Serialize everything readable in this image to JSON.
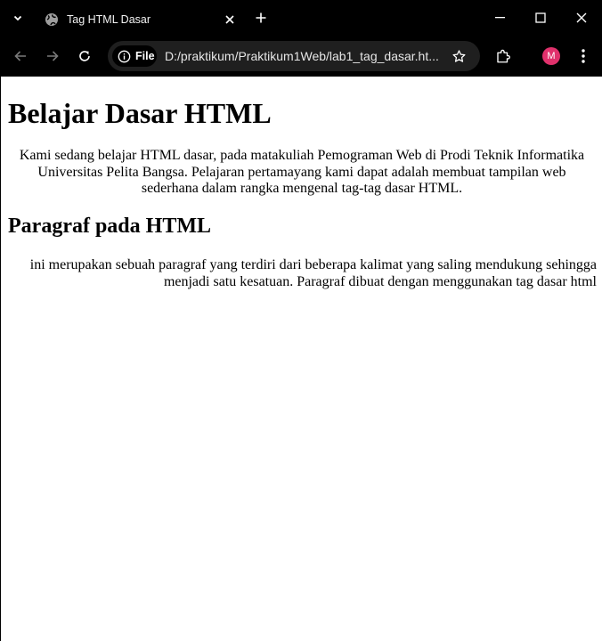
{
  "browser": {
    "tab": {
      "title": "Tag HTML Dasar"
    },
    "address_bar": {
      "chip_label": "File",
      "url": "D:/praktikum/Praktikum1Web/lab1_tag_dasar.ht..."
    },
    "profile": {
      "initial": "M",
      "color": "#e0316c"
    }
  },
  "page": {
    "heading": "Belajar Dasar HTML",
    "intro_paragraph": "Kami sedang belajar HTML dasar, pada matakuliah Pemograman Web di Prodi Teknik Informatika Universitas Pelita Bangsa. Pelajaran pertamayang kami dapat adalah membuat tampilan web sederhana dalam rangka mengenal tag-tag dasar HTML.",
    "subheading": "Paragraf pada HTML",
    "second_paragraph": "ini merupakan sebuah paragraf yang terdiri dari beberapa kalimat yang saling mendukung sehingga menjadi satu kesatuan. Paragraf dibuat dengan menggunakan tag dasar html"
  }
}
